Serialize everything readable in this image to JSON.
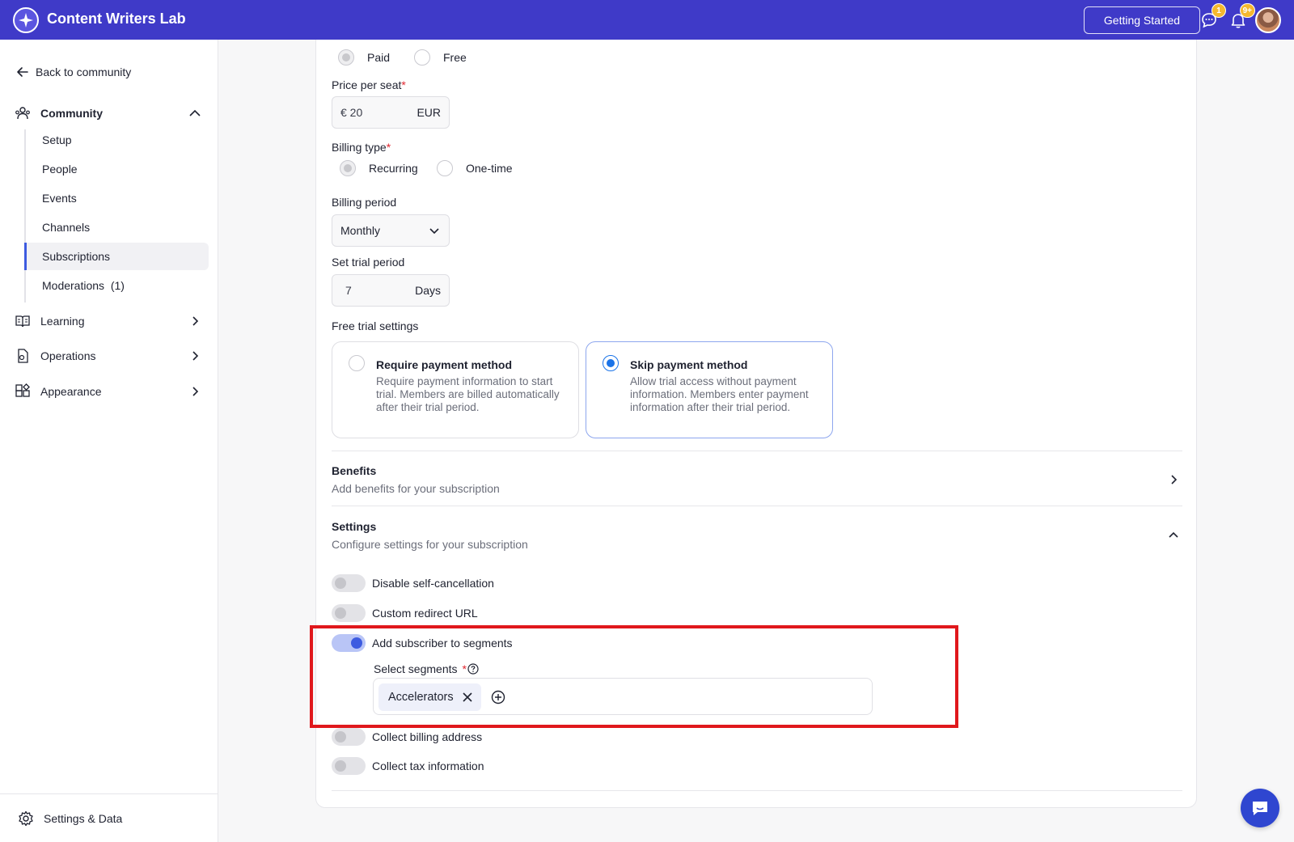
{
  "app": {
    "title": "Content Writers Lab"
  },
  "topbar": {
    "getting_started": "Getting Started",
    "messages_badge": "1",
    "notifications_badge": "9+"
  },
  "sidebar": {
    "back_label": "Back to community",
    "community_label": "Community",
    "community_items": [
      {
        "label": "Setup"
      },
      {
        "label": "People"
      },
      {
        "label": "Events"
      },
      {
        "label": "Channels"
      },
      {
        "label": "Subscriptions",
        "active": true
      },
      {
        "label": "Moderations  (1)"
      }
    ],
    "learning_label": "Learning",
    "operations_label": "Operations",
    "appearance_label": "Appearance",
    "footer_label": "Settings & Data"
  },
  "form": {
    "pricing": {
      "paid_label": "Paid",
      "free_label": "Free",
      "selected": "Paid"
    },
    "price": {
      "label": "Price per seat",
      "value": "€ 20",
      "currency": "EUR"
    },
    "billing_type": {
      "label": "Billing type",
      "recurring": "Recurring",
      "one_time": "One-time",
      "selected": "Recurring"
    },
    "billing_period": {
      "label": "Billing period",
      "value": "Monthly"
    },
    "trial": {
      "label": "Set trial period",
      "value": "7",
      "unit": "Days"
    },
    "free_trial": {
      "label": "Free trial settings",
      "require": {
        "title": "Require payment method",
        "desc": "Require payment information to start trial. Members are billed automatically after their trial period."
      },
      "skip": {
        "title": "Skip payment method",
        "desc": "Allow trial access without payment information. Members enter payment information after their trial period."
      },
      "selected": "skip"
    },
    "benefits": {
      "title": "Benefits",
      "subtitle": "Add benefits for your subscription"
    },
    "settings": {
      "title": "Settings",
      "subtitle": "Configure settings for your subscription",
      "toggles": [
        {
          "label": "Disable self-cancellation",
          "on": false
        },
        {
          "label": "Custom redirect URL",
          "on": false
        },
        {
          "label": "Add subscriber to segments",
          "on": true
        },
        {
          "label": "Collect billing address",
          "on": false
        },
        {
          "label": "Collect tax information",
          "on": false
        }
      ],
      "segments": {
        "label": "Select segments",
        "chips": [
          "Accelerators"
        ]
      }
    }
  },
  "colors": {
    "brand": "#3f3ac8",
    "accent": "#3d5be0",
    "highlight": "#e0181c",
    "badge": "#f5b82e"
  }
}
